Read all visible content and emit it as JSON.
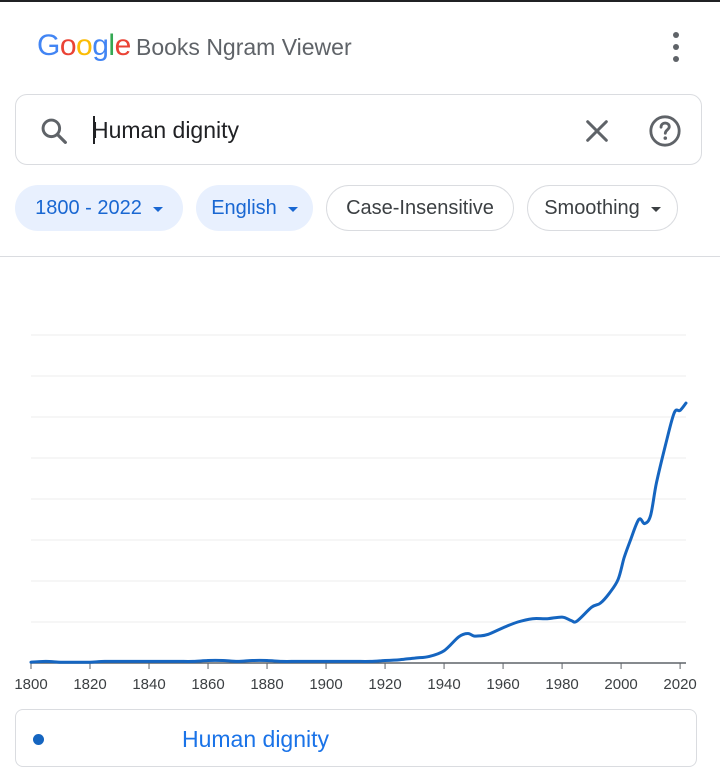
{
  "header": {
    "logo_letters": [
      {
        "char": "G",
        "color": "#4285F4"
      },
      {
        "char": "o",
        "color": "#EA4335"
      },
      {
        "char": "o",
        "color": "#FBBC05"
      },
      {
        "char": "g",
        "color": "#4285F4"
      },
      {
        "char": "l",
        "color": "#34A853"
      },
      {
        "char": "e",
        "color": "#EA4335"
      }
    ],
    "app_title": "Books Ngram Viewer",
    "menu_icon": "more-vert-icon"
  },
  "search": {
    "value": "Human dignity",
    "search_icon": "search-icon",
    "clear_icon": "close-icon",
    "help_icon": "help-circle-icon"
  },
  "filters": {
    "year_range": "1800 - 2022",
    "corpus": "English",
    "case_insensitive": "Case-Insensitive",
    "smoothing": "Smoothing"
  },
  "chart_data": {
    "type": "line",
    "xlim": [
      1800,
      2022
    ],
    "x_ticks": [
      "1800",
      "1820",
      "1840",
      "1860",
      "1880",
      "1900",
      "1920",
      "1940",
      "1960",
      "1980",
      "2000",
      "2020"
    ],
    "grid": "horizontal",
    "gridline_count": 8,
    "y_axis_labels": "none",
    "series": [
      {
        "name": "Human dignity",
        "color": "#1565c0",
        "x": [
          1800,
          1805,
          1810,
          1815,
          1820,
          1825,
          1830,
          1835,
          1840,
          1845,
          1850,
          1855,
          1860,
          1865,
          1870,
          1875,
          1880,
          1885,
          1890,
          1895,
          1900,
          1905,
          1910,
          1915,
          1920,
          1925,
          1930,
          1935,
          1940,
          1945,
          1948,
          1950,
          1952,
          1955,
          1960,
          1965,
          1970,
          1975,
          1980,
          1983,
          1985,
          1990,
          1993,
          1996,
          1999,
          2001,
          2003,
          2006,
          2008,
          2010,
          2012,
          2015,
          2018,
          2020,
          2022
        ],
        "y": [
          0.1,
          0.2,
          0.1,
          0.1,
          0.1,
          0.2,
          0.2,
          0.2,
          0.2,
          0.2,
          0.2,
          0.2,
          0.3,
          0.3,
          0.2,
          0.3,
          0.3,
          0.2,
          0.2,
          0.2,
          0.2,
          0.2,
          0.2,
          0.2,
          0.3,
          0.4,
          0.6,
          0.8,
          1.5,
          3.2,
          3.6,
          3.3,
          3.3,
          3.5,
          4.3,
          5.0,
          5.4,
          5.4,
          5.6,
          5.2,
          5.1,
          6.8,
          7.3,
          8.5,
          10.2,
          12.8,
          14.8,
          17.5,
          17.0,
          18.0,
          22.0,
          26.5,
          30.5,
          30.8,
          31.7
        ]
      }
    ]
  },
  "legend": {
    "items": [
      {
        "label": "Human dignity",
        "color": "#1565c0"
      }
    ]
  }
}
